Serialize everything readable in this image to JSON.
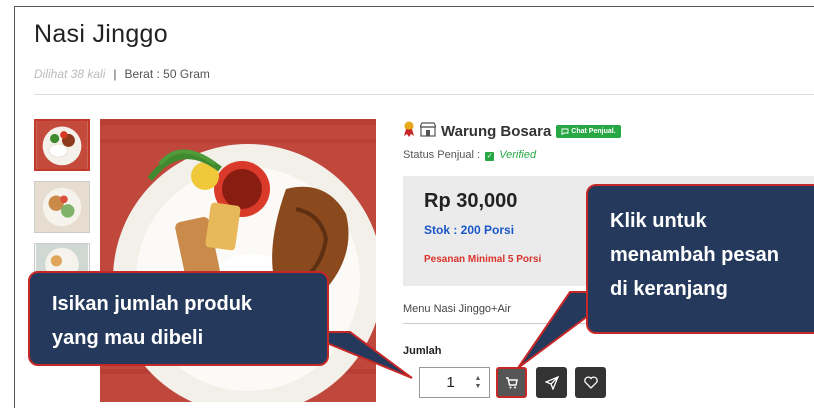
{
  "product": {
    "title": "Nasi Jinggo",
    "views": "Dilihat 38 kali",
    "separator": "|",
    "weight": "Berat : 50 Gram"
  },
  "seller": {
    "name": "Warung Bosara",
    "chat_label": "Chat Penjual.",
    "status_label": "Status Penjual :",
    "status_value": "Verified"
  },
  "price_box": {
    "price": "Rp 30,000",
    "stock": "Stok : 200 Porsi",
    "min_order": "Pesanan Minimal 5 Porsi"
  },
  "variant": {
    "label": "Menu Nasi Jinggo+Air"
  },
  "quantity": {
    "label": "Jumlah",
    "value": "1"
  },
  "callouts": {
    "left_line1": "Isikan jumlah produk",
    "left_line2": "yang mau dibeli",
    "right_line1": "Klik untuk",
    "right_line2": "menambah pesan",
    "right_line3": "di keranjang"
  },
  "icons": {
    "seller_badge": "award-icon",
    "shop": "store-icon",
    "chat": "chat-icon",
    "verified": "check-icon",
    "cart": "cart-icon",
    "send": "send-icon",
    "wishlist": "heart-icon",
    "spinner_up": "chevron-up-icon",
    "spinner_down": "chevron-down-icon"
  },
  "colors": {
    "accent_green": "#28a745",
    "stock_blue": "#1a56c8",
    "min_order_red": "#d9342b",
    "callout_bg": "#24395c",
    "callout_border": "#c62828"
  }
}
